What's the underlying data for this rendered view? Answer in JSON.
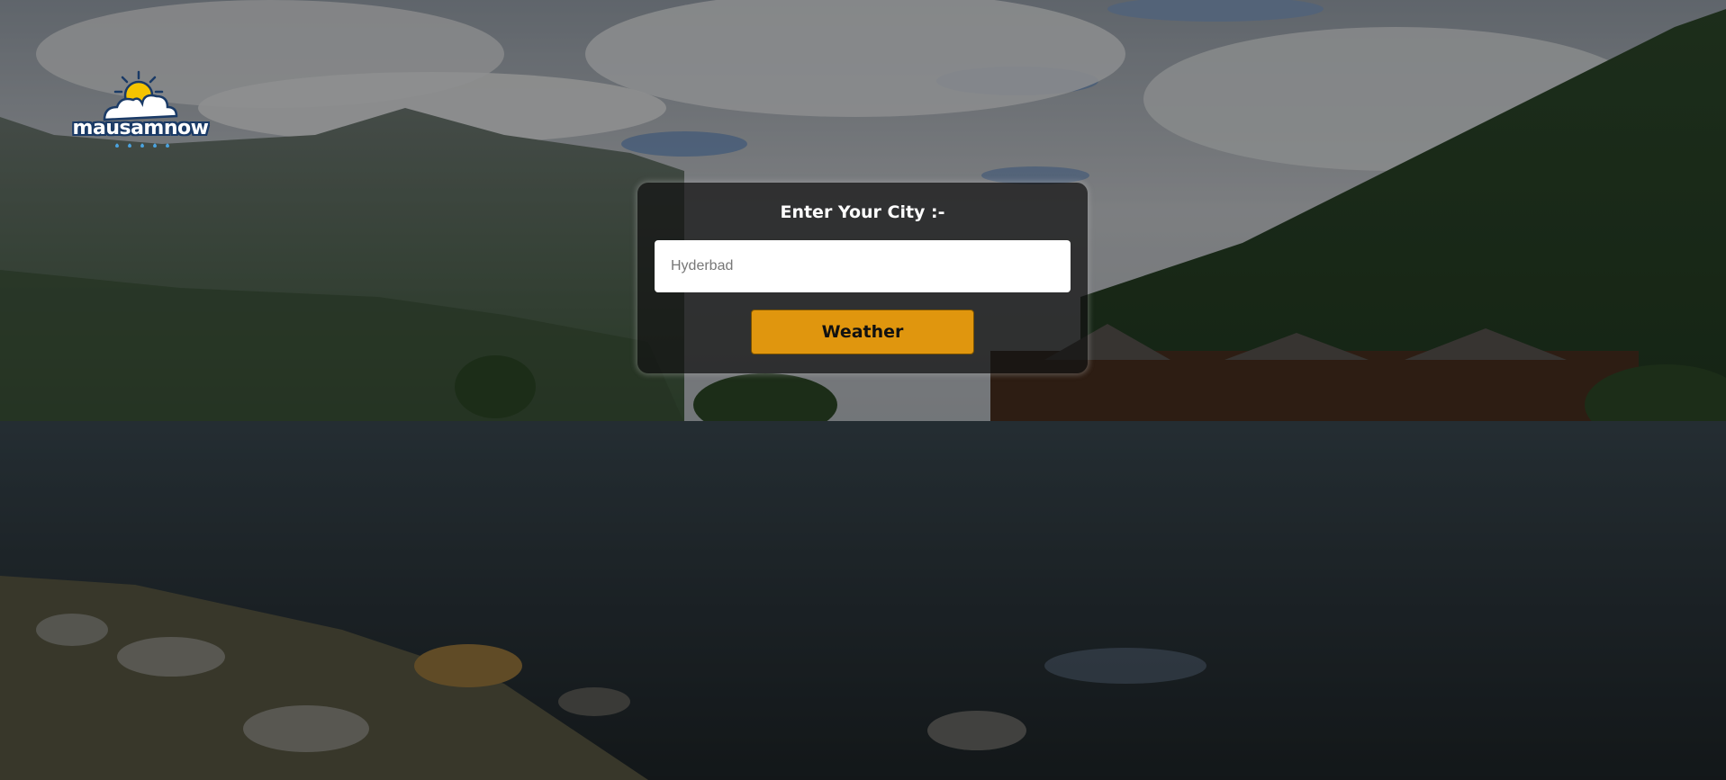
{
  "brand": {
    "logo_text": "mausamnow",
    "logo_icon": "sun-cloud-rain-icon"
  },
  "search": {
    "title": "Enter Your City :-",
    "placeholder": "Hyderbad",
    "value": "",
    "button_label": "Weather"
  },
  "colors": {
    "button_bg": "#e0960e",
    "panel_bg": "#141414",
    "logo_outline": "#1a3a66",
    "sun": "#f5c400"
  },
  "background": {
    "scene": "fjord-landscape-image"
  }
}
